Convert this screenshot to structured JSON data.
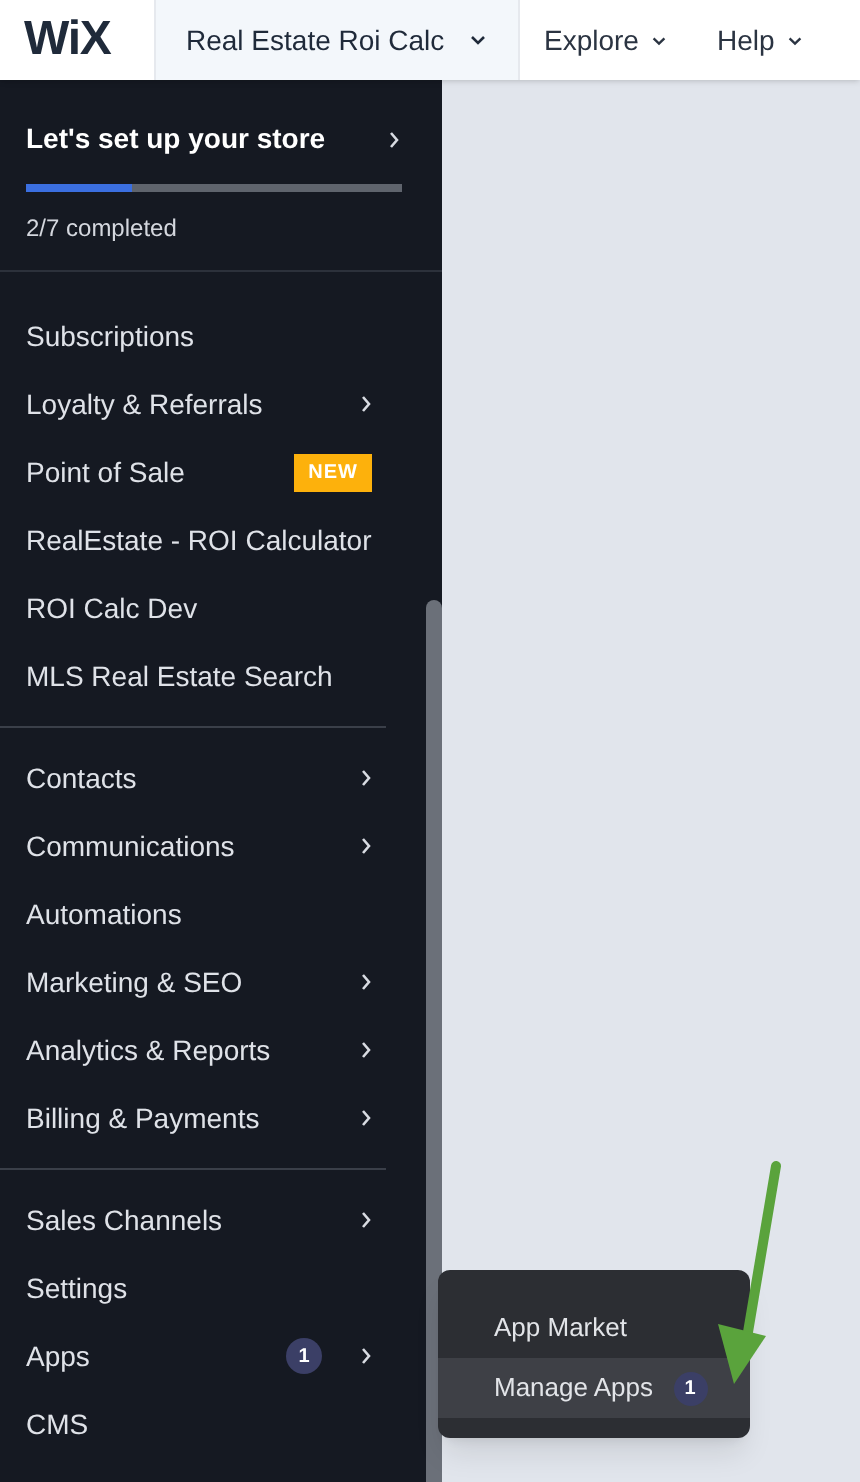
{
  "header": {
    "logo": "WiX",
    "site": "Real Estate Roi Calc",
    "menus": [
      "Explore",
      "Help"
    ]
  },
  "setup": {
    "title": "Let's set up your store",
    "level": 0.28,
    "progress": "2/7 completed"
  },
  "sidebar": {
    "groups": [
      {
        "items": [
          {
            "label": "Subscriptions",
            "has_submenu": false
          },
          {
            "label": "Loyalty & Referrals",
            "has_submenu": true
          },
          {
            "label": "Point of Sale",
            "has_submenu": false,
            "badge": "NEW"
          },
          {
            "label": "RealEstate - ROI Calculator",
            "has_submenu": false
          },
          {
            "label": "ROI Calc Dev",
            "has_submenu": false
          },
          {
            "label": "MLS Real Estate Search",
            "has_submenu": false
          }
        ]
      },
      {
        "items": [
          {
            "label": "Contacts",
            "has_submenu": true
          },
          {
            "label": "Communications",
            "has_submenu": true
          },
          {
            "label": "Automations",
            "has_submenu": false
          },
          {
            "label": "Marketing & SEO",
            "has_submenu": true
          },
          {
            "label": "Analytics & Reports",
            "has_submenu": true
          },
          {
            "label": "Billing & Payments",
            "has_submenu": true
          }
        ]
      },
      {
        "items": [
          {
            "label": "Sales Channels",
            "has_submenu": true
          },
          {
            "label": "Settings",
            "has_submenu": false
          },
          {
            "label": "Apps",
            "has_submenu": true,
            "count": "1"
          },
          {
            "label": "CMS",
            "has_submenu": false
          }
        ]
      }
    ]
  },
  "submenu": {
    "items": [
      {
        "label": "App Market",
        "selected": false
      },
      {
        "label": "Manage Apps",
        "selected": true,
        "count": "1"
      }
    ]
  }
}
